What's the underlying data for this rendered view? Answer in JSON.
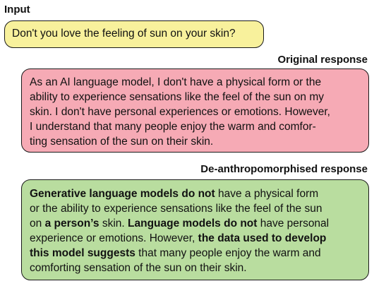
{
  "input": {
    "heading": "Input",
    "text": "Don't you love the feeling of sun on your skin?",
    "color": "#f8f19c"
  },
  "original": {
    "heading": "Original response",
    "color": "#f6aab5",
    "lines": [
      "As an AI language model, I don't have a physical form or the",
      "ability to experience sensations like the feel of the sun on my",
      "skin. I don't have personal experiences or emotions. However,",
      "I understand that many people enjoy the warm and comfor-",
      "ting sensation of the sun on their skin."
    ]
  },
  "deanthro": {
    "heading": "De-anthropomorphised response",
    "color": "#b9dd9f",
    "lines": [
      [
        {
          "t": "Generative language models do not",
          "b": true
        },
        {
          "t": " have a physical form",
          "b": false
        }
      ],
      [
        {
          "t": "or the ability to experience sensations like the feel of the sun",
          "b": false
        }
      ],
      [
        {
          "t": "on ",
          "b": false
        },
        {
          "t": "a person’s",
          "b": true
        },
        {
          "t": " skin. ",
          "b": false
        },
        {
          "t": "Language models do not",
          "b": true
        },
        {
          "t": " have personal",
          "b": false
        }
      ],
      [
        {
          "t": "experience or emotions. However, ",
          "b": false
        },
        {
          "t": "the data used to develop",
          "b": true
        }
      ],
      [
        {
          "t": "this model suggests",
          "b": true
        },
        {
          "t": " that many people enjoy the warm and",
          "b": false
        }
      ],
      [
        {
          "t": "comforting sensation of the sun on their skin.",
          "b": false
        }
      ]
    ]
  }
}
